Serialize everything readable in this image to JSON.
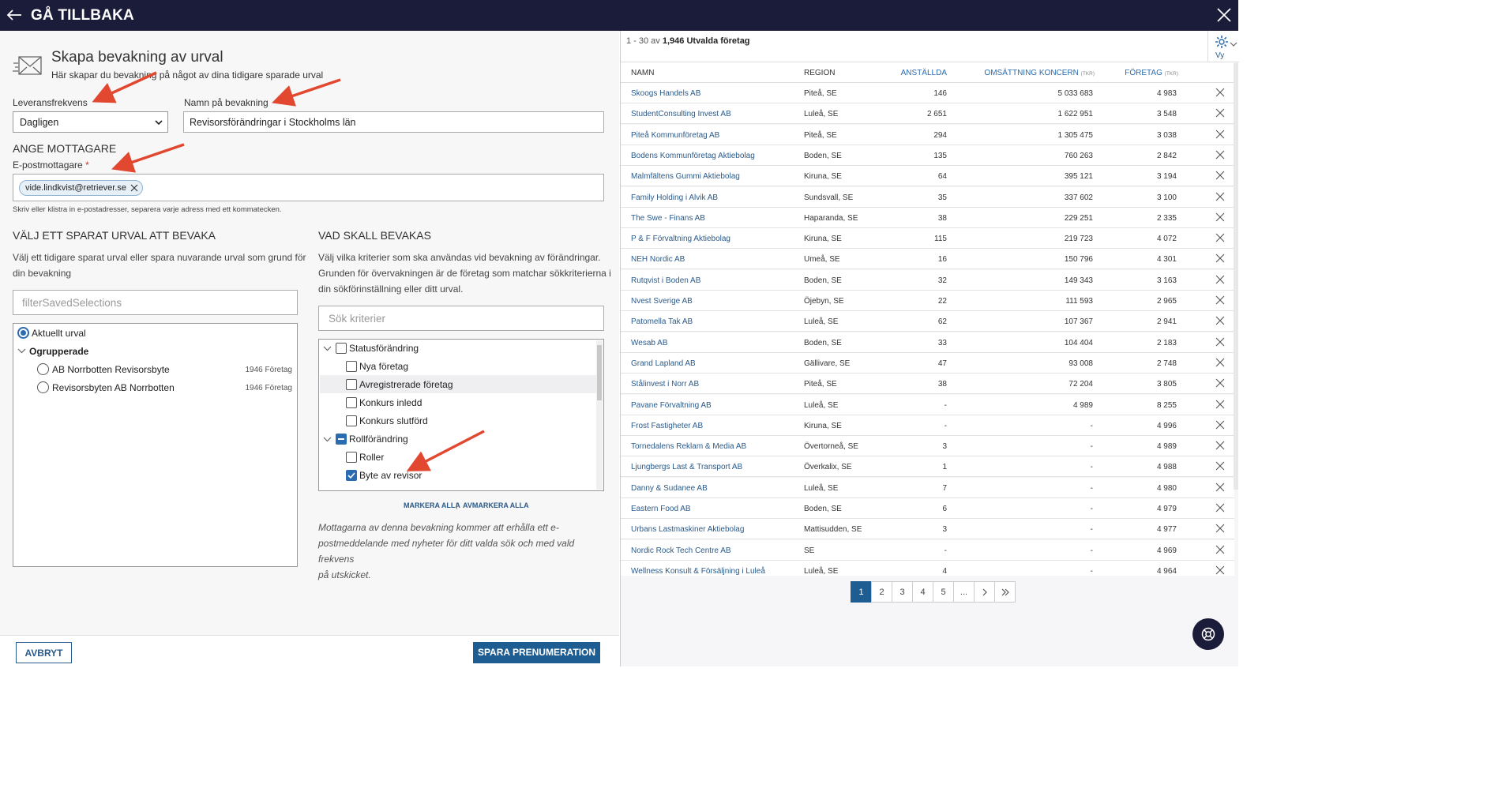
{
  "topbar": {
    "back_label": "GÅ TILLBAKA"
  },
  "form": {
    "heading": "Skapa bevakning av urval",
    "subheading": "Här skapar du bevakning på något av dina tidigare sparade urval",
    "frequency_label": "Leveransfrekvens",
    "frequency_value": "Dagligen",
    "name_label": "Namn på bevakning",
    "name_value": "Revisorsförändringar i Stockholms län",
    "recipients_title": "ANGE MOTTAGARE",
    "email_label": "E-postmottagare",
    "required_mark": "*",
    "email_chip": "vide.lindkvist@retriever.se",
    "email_hint": "Skriv eller klistra in e-postadresser, separera varje adress med ett kommatecken."
  },
  "saved": {
    "title": "VÄLJ ETT SPARAT URVAL ATT BEVAKA",
    "desc1": "Välj ett tidigare sparat urval eller spara nuvarande urval som grund för",
    "desc2": "din bevakning",
    "filter_placeholder": "filterSavedSelections",
    "current": "Aktuellt urval",
    "group": "Ogrupperade",
    "items": [
      {
        "label": "AB Norrbotten Revisorsbyte",
        "count": "1946 Företag"
      },
      {
        "label": "Revisorsbyten AB Norrbotten",
        "count": "1946 Företag"
      }
    ]
  },
  "watch": {
    "title": "VAD SKALL BEVAKAS",
    "desc1": "Välj vilka kriterier som ska användas vid bevakning av förändringar.",
    "desc2": "Grunden för övervakningen är de företag som matchar sökkriterierna i",
    "desc3": "din sökförinställning eller ditt urval.",
    "search_placeholder": "Sök kriterier",
    "tree": [
      {
        "label": "Statusförändring",
        "level": 0,
        "state": "unchecked",
        "expandable": true
      },
      {
        "label": "Nya företag",
        "level": 1,
        "state": "unchecked"
      },
      {
        "label": "Avregistrerade företag",
        "level": 1,
        "state": "unchecked",
        "hover": true
      },
      {
        "label": "Konkurs inledd",
        "level": 1,
        "state": "unchecked"
      },
      {
        "label": "Konkurs slutförd",
        "level": 1,
        "state": "unchecked"
      },
      {
        "label": "Rollförändring",
        "level": 0,
        "state": "partial",
        "expandable": true
      },
      {
        "label": "Roller",
        "level": 1,
        "state": "unchecked"
      },
      {
        "label": "Byte av revisor",
        "level": 1,
        "state": "checked"
      }
    ],
    "select_all": "MARKERA ALLA",
    "separator": "|",
    "deselect_all": "AVMARKERA ALLA",
    "note1": "Mottagarna av denna bevakning kommer att erhålla ett e-",
    "note2": "postmeddelande med nyheter för ditt valda sök och med vald frekvens",
    "note3": "på utskicket."
  },
  "footer": {
    "cancel": "AVBRYT",
    "save": "SPARA PRENUMERATION"
  },
  "results": {
    "range": "1 - 30 av",
    "total": "1,946 Utvalda företag",
    "view_label": "Vy",
    "columns": {
      "name": "NAMN",
      "region": "REGION",
      "employees": "ANSTÄLLDA",
      "turnover": "OMSÄTTNING KONCERN",
      "turnover_unit": "(TKR)",
      "company": "FÖRETAG",
      "company_unit": "(TKR)"
    },
    "rows": [
      {
        "name": "Skoogs Handels AB",
        "region": "Piteå, SE",
        "employees": "146",
        "turnover": "5 033 683",
        "company": "4 983"
      },
      {
        "name": "StudentConsulting Invest AB",
        "region": "Luleå, SE",
        "employees": "2 651",
        "turnover": "1 622 951",
        "company": "3 548"
      },
      {
        "name": "Piteå Kommunföretag AB",
        "region": "Piteå, SE",
        "employees": "294",
        "turnover": "1 305 475",
        "company": "3 038"
      },
      {
        "name": "Bodens Kommunföretag Aktiebolag",
        "region": "Boden, SE",
        "employees": "135",
        "turnover": "760 263",
        "company": "2 842"
      },
      {
        "name": "Malmfältens Gummi Aktiebolag",
        "region": "Kiruna, SE",
        "employees": "64",
        "turnover": "395 121",
        "company": "3 194"
      },
      {
        "name": "Family Holding i Alvik AB",
        "region": "Sundsvall, SE",
        "employees": "35",
        "turnover": "337 602",
        "company": "3 100"
      },
      {
        "name": "The Swe - Finans AB",
        "region": "Haparanda, SE",
        "employees": "38",
        "turnover": "229 251",
        "company": "2 335"
      },
      {
        "name": "P & F Förvaltning Aktiebolag",
        "region": "Kiruna, SE",
        "employees": "115",
        "turnover": "219 723",
        "company": "4 072"
      },
      {
        "name": "NEH Nordic AB",
        "region": "Umeå, SE",
        "employees": "16",
        "turnover": "150 796",
        "company": "4 301"
      },
      {
        "name": "Rutqvist i Boden AB",
        "region": "Boden, SE",
        "employees": "32",
        "turnover": "149 343",
        "company": "3 163"
      },
      {
        "name": "Nvest Sverige AB",
        "region": "Öjebyn, SE",
        "employees": "22",
        "turnover": "111 593",
        "company": "2 965"
      },
      {
        "name": "Patomella Tak AB",
        "region": "Luleå, SE",
        "employees": "62",
        "turnover": "107 367",
        "company": "2 941"
      },
      {
        "name": "Wesab AB",
        "region": "Boden, SE",
        "employees": "33",
        "turnover": "104 404",
        "company": "2 183"
      },
      {
        "name": "Grand Lapland AB",
        "region": "Gällivare, SE",
        "employees": "47",
        "turnover": "93 008",
        "company": "2 748"
      },
      {
        "name": "Stålinvest i Norr AB",
        "region": "Piteå, SE",
        "employees": "38",
        "turnover": "72 204",
        "company": "3 805"
      },
      {
        "name": "Pavane Förvaltning AB",
        "region": "Luleå, SE",
        "employees": "-",
        "turnover": "4 989",
        "company": "8 255"
      },
      {
        "name": "Frost Fastigheter AB",
        "region": "Kiruna, SE",
        "employees": "-",
        "turnover": "-",
        "company": "4 996"
      },
      {
        "name": "Tornedalens Reklam & Media AB",
        "region": "Övertorneå, SE",
        "employees": "3",
        "turnover": "-",
        "company": "4 989"
      },
      {
        "name": "Ljungbergs Last & Transport AB",
        "region": "Överkalix, SE",
        "employees": "1",
        "turnover": "-",
        "company": "4 988"
      },
      {
        "name": "Danny & Sudanee AB",
        "region": "Luleå, SE",
        "employees": "7",
        "turnover": "-",
        "company": "4 980"
      },
      {
        "name": "Eastern Food AB",
        "region": "Boden, SE",
        "employees": "6",
        "turnover": "-",
        "company": "4 979"
      },
      {
        "name": "Urbans Lastmaskiner Aktiebolag",
        "region": "Mattisudden, SE",
        "employees": "3",
        "turnover": "-",
        "company": "4 977"
      },
      {
        "name": "Nordic Rock Tech Centre AB",
        "region": "SE",
        "employees": "-",
        "turnover": "-",
        "company": "4 969"
      },
      {
        "name": "Wellness Konsult & Försäljning i Luleå",
        "region": "Luleå, SE",
        "employees": "4",
        "turnover": "-",
        "company": "4 964"
      }
    ],
    "pages": [
      "1",
      "2",
      "3",
      "4",
      "5",
      "..."
    ],
    "active_page": "1"
  }
}
